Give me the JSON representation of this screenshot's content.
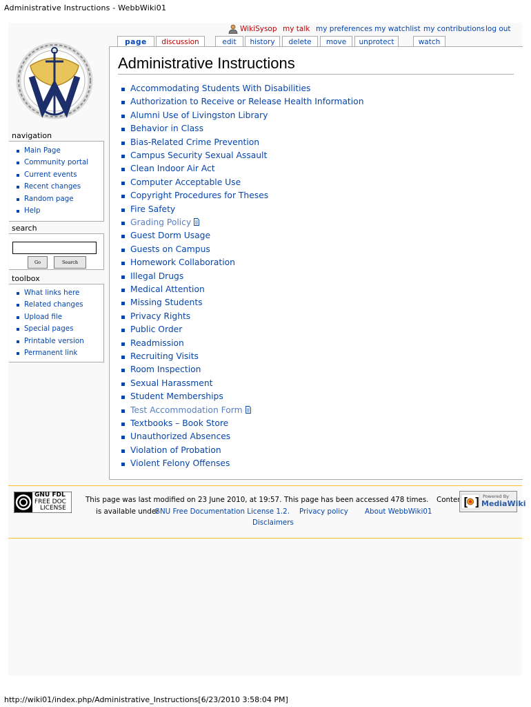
{
  "print": {
    "header": "Administrative Instructions - WebbWiki01",
    "footer": "http://wiki01/index.php/Administrative_Instructions[6/23/2010 3:58:04 PM]"
  },
  "personal_tools": {
    "user": "WikiSysop",
    "talk": "my talk",
    "preferences": "my preferences",
    "watchlist": "my watchlist",
    "contributions": "my contributions",
    "logout": "log out"
  },
  "tabs": {
    "page": "page",
    "discussion": "discussion",
    "edit": "edit",
    "history": "history",
    "delete": "delete",
    "move": "move",
    "unprotect": "unprotect",
    "watch": "watch"
  },
  "page_title": "Administrative Instructions",
  "instructions": [
    {
      "label": "Accommodating Students With Disabilities"
    },
    {
      "label": "Authorization to Receive or Release Health Information"
    },
    {
      "label": "Alumni Use of Livingston Library"
    },
    {
      "label": "Behavior in Class"
    },
    {
      "label": "Bias-Related Crime Prevention"
    },
    {
      "label": "Campus Security Sexual Assault"
    },
    {
      "label": "Clean Indoor Air Act"
    },
    {
      "label": "Computer Acceptable Use"
    },
    {
      "label": "Copyright Procedures for Theses"
    },
    {
      "label": "Fire Safety"
    },
    {
      "label": "Grading Policy",
      "file": true
    },
    {
      "label": "Guest Dorm Usage"
    },
    {
      "label": "Guests on Campus"
    },
    {
      "label": "Homework Collaboration"
    },
    {
      "label": "Illegal Drugs"
    },
    {
      "label": "Medical Attention"
    },
    {
      "label": "Missing Students"
    },
    {
      "label": "Privacy Rights"
    },
    {
      "label": "Public Order"
    },
    {
      "label": "Readmission"
    },
    {
      "label": "Recruiting Visits"
    },
    {
      "label": "Room Inspection"
    },
    {
      "label": "Sexual Harassment"
    },
    {
      "label": "Student Memberships"
    },
    {
      "label": "Test Accommodation Form",
      "file": true
    },
    {
      "label": "Textbooks – Book Store"
    },
    {
      "label": "Unauthorized Absences"
    },
    {
      "label": "Violation of Probation"
    },
    {
      "label": "Violent Felony Offenses"
    }
  ],
  "navigation": {
    "title": "navigation",
    "items": [
      "Main Page",
      "Community portal",
      "Current events",
      "Recent changes",
      "Random page",
      "Help"
    ]
  },
  "search": {
    "title": "search",
    "value": "",
    "go": "Go",
    "search": "Search"
  },
  "toolbox": {
    "title": "toolbox",
    "items": [
      "What links here",
      "Related changes",
      "Upload file",
      "Special pages",
      "Printable version",
      "Permanent link"
    ]
  },
  "footer": {
    "last_modified": "This page was last modified on 23 June 2010, at 19:57.",
    "accessed": "This page has been accessed 478 times.",
    "content_prefix": "Conten",
    "available_under": "is available under",
    "license_link": "GNU Free Documentation License 1.2.",
    "privacy": "Privacy policy",
    "about": "About WebbWiki01",
    "disclaimers": "Disclaimers",
    "gnu_badge_text": [
      "GNU FDL",
      "FREE DOC",
      "LICENSE"
    ],
    "mediawiki_badge_text": [
      "Powered By",
      "MediaWiki"
    ]
  },
  "colors": {
    "link": "#0645ad",
    "new_link": "#ba0000",
    "border": "#aaaaaa",
    "footer_line": "#ffbe2e",
    "background": "#f9f9f9"
  }
}
